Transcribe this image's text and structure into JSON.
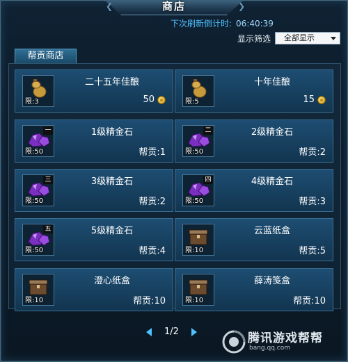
{
  "window": {
    "title": "商店"
  },
  "refresh": {
    "label": "下次刷新倒计时:",
    "time": "06:40:39"
  },
  "filter": {
    "label": "显示筛选",
    "selected": "全部显示"
  },
  "tab": {
    "label": "帮贡商店"
  },
  "items": [
    {
      "name": "二十五年佳酿",
      "limit": "限:3",
      "price": "50",
      "currency": "coin",
      "icon": "gourd-icon"
    },
    {
      "name": "十年佳酿",
      "limit": "限:5",
      "price": "15",
      "currency": "coin",
      "icon": "gourd-icon"
    },
    {
      "name": "1级精金石",
      "limit": "限:50",
      "price": "帮贡:1",
      "currency": "contribution",
      "grade": "一",
      "icon": "ore-icon"
    },
    {
      "name": "2级精金石",
      "limit": "限:50",
      "price": "帮贡:2",
      "currency": "contribution",
      "grade": "二",
      "icon": "ore-icon"
    },
    {
      "name": "3级精金石",
      "limit": "限:50",
      "price": "帮贡:2",
      "currency": "contribution",
      "grade": "三",
      "icon": "ore-icon"
    },
    {
      "name": "4级精金石",
      "limit": "限:50",
      "price": "帮贡:3",
      "currency": "contribution",
      "grade": "四",
      "icon": "ore-icon"
    },
    {
      "name": "5级精金石",
      "limit": "限:50",
      "price": "帮贡:4",
      "currency": "contribution",
      "grade": "五",
      "icon": "ore-icon"
    },
    {
      "name": "云蓝纸盒",
      "limit": "限:10",
      "price": "帮贡:5",
      "currency": "contribution",
      "icon": "box-icon"
    },
    {
      "name": "澄心纸盒",
      "limit": "限:10",
      "price": "帮贡:10",
      "currency": "contribution",
      "icon": "box-icon"
    },
    {
      "name": "薛涛笺盒",
      "limit": "限:10",
      "price": "帮贡:10",
      "currency": "contribution",
      "icon": "box-icon"
    }
  ],
  "pager": {
    "text": "1/2"
  },
  "watermark": {
    "brand": "腾讯游戏帮帮",
    "url": "bang.qq.com"
  },
  "colors": {
    "accent": "#4ec2ff",
    "card": "#1d4d72",
    "coin": "#e2b43a",
    "ore": "#7a2fc0"
  }
}
